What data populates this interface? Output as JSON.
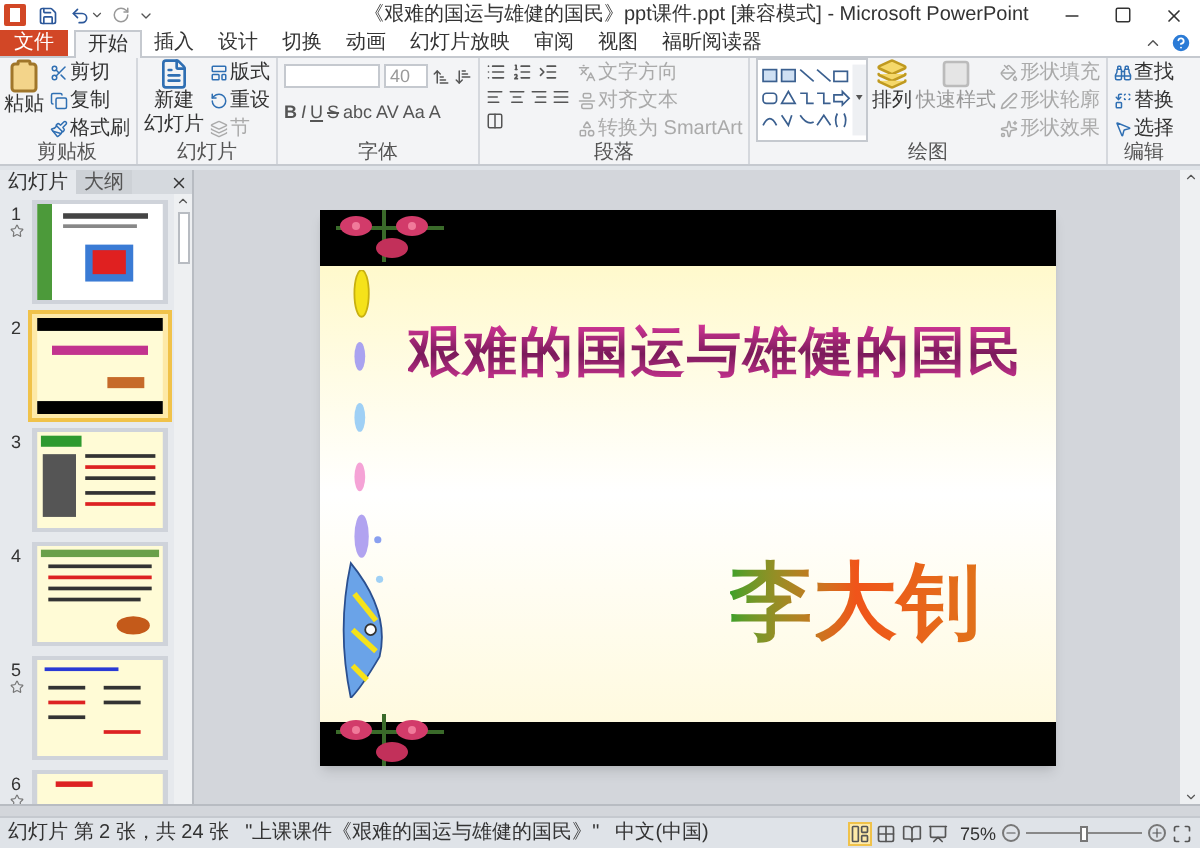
{
  "window": {
    "title": "《艰难的国运与雄健的国民》ppt课件.ppt [兼容模式] - Microsoft PowerPoint"
  },
  "tabs": [
    {
      "label": "文件",
      "kind": "file",
      "selected": false
    },
    {
      "label": "开始",
      "kind": "tab",
      "selected": true
    },
    {
      "label": "插入",
      "kind": "tab",
      "selected": false
    },
    {
      "label": "设计",
      "kind": "tab",
      "selected": false
    },
    {
      "label": "切换",
      "kind": "tab",
      "selected": false
    },
    {
      "label": "动画",
      "kind": "tab",
      "selected": false
    },
    {
      "label": "幻灯片放映",
      "kind": "tab",
      "selected": false
    },
    {
      "label": "审阅",
      "kind": "tab",
      "selected": false
    },
    {
      "label": "视图",
      "kind": "tab",
      "selected": false
    },
    {
      "label": "福昕阅读器",
      "kind": "tab",
      "selected": false
    }
  ],
  "ribbon": {
    "clipboard": {
      "label": "剪贴板",
      "paste": "粘贴",
      "items": [
        "剪切",
        "复制",
        "格式刷"
      ]
    },
    "slides": {
      "label": "幻灯片",
      "new_slide": "新建",
      "new_slide_2": "幻灯片",
      "items": [
        {
          "label": "版式",
          "disabled": false
        },
        {
          "label": "重设",
          "disabled": false
        },
        {
          "label": "节",
          "disabled": true
        }
      ]
    },
    "font": {
      "label": "字体",
      "size": "40",
      "format_buttons": [
        "B",
        "I",
        "U",
        "S",
        "abc",
        "AV",
        "Aa",
        "A"
      ]
    },
    "paragraph": {
      "label": "段落",
      "items": [
        "文字方向",
        "对齐文本",
        "转换为 SmartArt"
      ]
    },
    "drawing": {
      "label": "绘图",
      "arrange": "排列",
      "quick_styles": "快速样式",
      "items": [
        "形状填充",
        "形状轮廓",
        "形状效果"
      ]
    },
    "editing": {
      "label": "编辑",
      "items": [
        "查找",
        "替换",
        "选择"
      ]
    }
  },
  "pane_tabs": [
    {
      "label": "幻灯片",
      "selected": true
    },
    {
      "label": "大纲",
      "selected": false
    }
  ],
  "thumbnails": [
    {
      "number": "1",
      "selected": false,
      "animated": true
    },
    {
      "number": "2",
      "selected": true,
      "animated": false
    },
    {
      "number": "3",
      "selected": false,
      "animated": false
    },
    {
      "number": "4",
      "selected": false,
      "animated": false
    },
    {
      "number": "5",
      "selected": false,
      "animated": true
    },
    {
      "number": "6",
      "selected": false,
      "animated": true
    }
  ],
  "slide": {
    "title": "艰难的国运与雄健的国民",
    "author": "李大钊"
  },
  "status_bar": {
    "slide_info": "幻灯片 第 2 张，共 24 张",
    "theme": "\"上课课件《艰难的国运与雄健的国民》\"",
    "language": "中文(中国)",
    "zoom": "75%",
    "zoom_slider": {
      "level": 0.5
    }
  }
}
